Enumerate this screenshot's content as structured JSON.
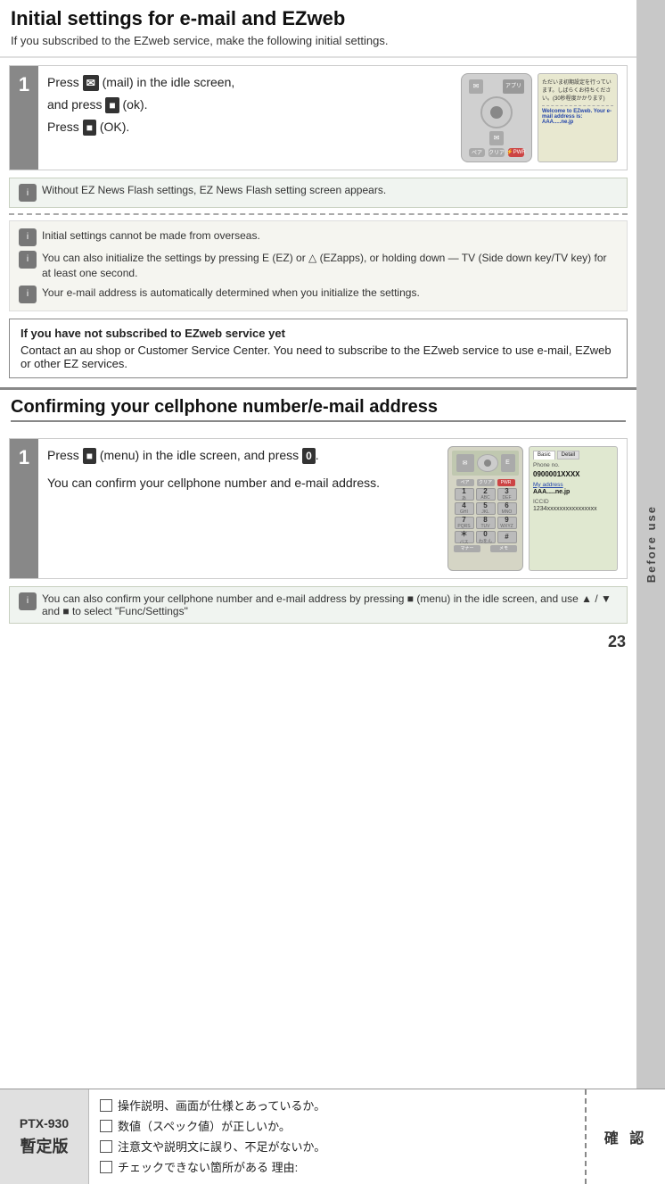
{
  "page": {
    "page_number": "23",
    "sidebar_label": "Before use"
  },
  "section1": {
    "title": "Initial settings for e-mail and EZweb",
    "subtitle": "If you subscribed to the EZweb service, make the following initial settings.",
    "step1": {
      "number": "1",
      "line1": "Press  ■  (mail) in the idle screen,",
      "line2": "and press  ■  (ok).",
      "line3": "Press  ■  (OK).",
      "screen_text1": "ただいま初期設定を行っています。しばらくお待ちください。(30秒程度かかります)",
      "screen_text2": "Welcome to EZweb. Your e-mail address is: AAA.....ne.jp"
    },
    "info_box": {
      "icon": "i",
      "text": "Without EZ News Flash settings, EZ News Flash setting screen appears."
    },
    "notes": [
      {
        "icon": "i",
        "text": "Initial settings cannot be made from overseas."
      },
      {
        "icon": "i",
        "text": "You can also initialize the settings by pressing  E  (EZ) or  △  (EZapps), or holding down  —  TV (Side down key/TV key) for at least one second."
      },
      {
        "icon": "i",
        "text": "Your e-mail address is automatically determined when you initialize the settings."
      }
    ],
    "warning": {
      "title": "If you have not subscribed to EZweb service yet",
      "text": "Contact an au shop or Customer Service Center. You need to subscribe to the EZweb service to use e-mail, EZweb or other EZ services."
    }
  },
  "section2": {
    "title": "Confirming your cellphone number/e-mail address",
    "step1": {
      "number": "1",
      "line1": "Press  ■  (menu) in the idle screen, and press  0 .",
      "line2": "You can confirm your cellphone number and e-mail address.",
      "screen_phone": "0900001XXXX",
      "screen_address_label": "My address",
      "screen_address": "AAA.....ne.jp",
      "screen_id_label": "ICCID",
      "screen_id": "1234xxxxxxxxxxxxxxxx"
    },
    "info_box": {
      "icon": "i",
      "text": "You can also confirm your cellphone number and e-mail address by pressing  ■  (menu) in the idle screen, and use  ▲ / ▼  and  ■  to select \"Func/Settings\""
    }
  },
  "footer": {
    "model": "PTX-930",
    "draft_label": "暫定版",
    "checklist": [
      "操作説明、画面が仕様とあっているか。",
      "数値（スペック値）が正しいか。",
      "注意文や説明文に誤り、不足がないか。",
      "チェックできない箇所がある 理由:"
    ],
    "confirm_label": "確 認"
  }
}
